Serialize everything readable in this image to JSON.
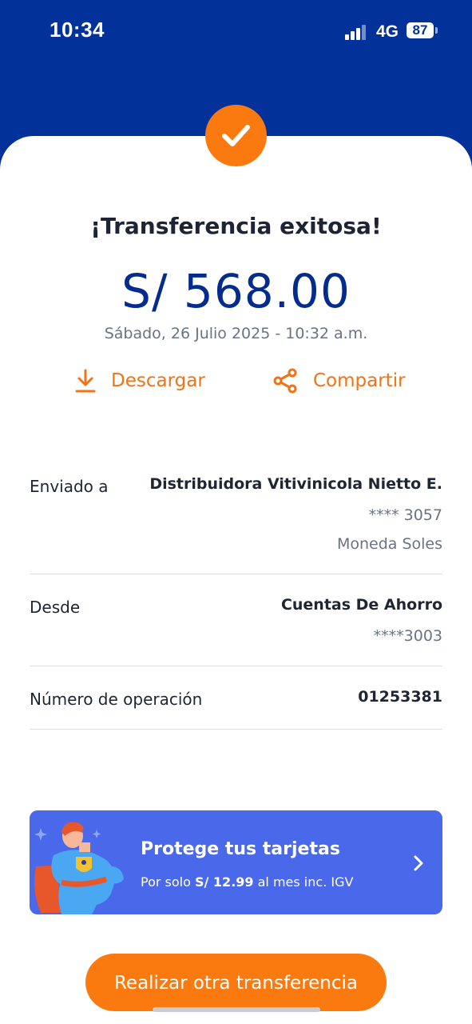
{
  "status_bar": {
    "time": "10:34",
    "network": "4G",
    "battery": "87"
  },
  "success": {
    "title": "¡Transferencia exitosa!",
    "amount": "S/ 568.00",
    "datetime": "Sábado, 26 Julio 2025 - 10:32 a.m."
  },
  "actions": {
    "download_label": "Descargar",
    "share_label": "Compartir"
  },
  "details": {
    "sent_to": {
      "label": "Enviado a",
      "name": "Distribuidora Vitivinicola Nietto E.",
      "account": "**** 3057",
      "currency": "Moneda Soles"
    },
    "from": {
      "label": "Desde",
      "account_type": "Cuentas De Ahorro",
      "account": "****3003"
    },
    "operation": {
      "label": "Número de operación",
      "number": "01253381"
    }
  },
  "promo": {
    "title": "Protege tus tarjetas",
    "subtitle_prefix": "Por solo ",
    "price": "S/ 12.99",
    "subtitle_suffix": " al mes inc. IGV"
  },
  "cta_label": "Realizar otra transferencia",
  "colors": {
    "header_bg": "#03319a",
    "accent_orange": "#fb7a10",
    "amount_blue": "#042c8d",
    "promo_bg": "#4a68ea"
  },
  "icons": [
    "check-icon",
    "download-icon",
    "share-icon",
    "chevron-right-icon",
    "superhero-illustration"
  ]
}
